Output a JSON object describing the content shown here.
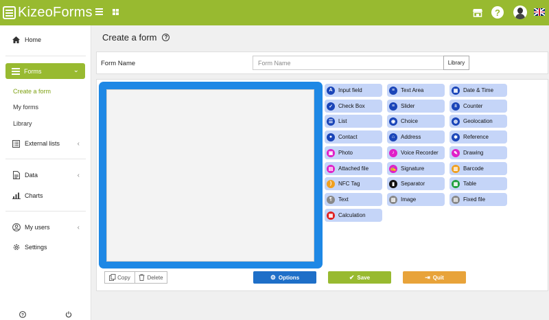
{
  "header": {
    "logo_prefix": "Kizeo",
    "logo_suffix": "Forms",
    "icons": [
      "menu-icon",
      "grid-icon",
      "store-icon",
      "help-icon",
      "avatar",
      "uk-flag-icon"
    ],
    "help_glyph": "?",
    "accent_color": "#98ba30"
  },
  "sidebar": {
    "home": "Home",
    "forms": "Forms",
    "forms_sub": [
      "Create a form",
      "My forms",
      "Library"
    ],
    "external_lists": "External lists",
    "data": "Data",
    "charts": "Charts",
    "my_users": "My users",
    "settings": "Settings"
  },
  "page": {
    "title": "Create a form",
    "title_help": "?"
  },
  "form_name": {
    "label": "Form Name",
    "value": "",
    "placeholder": "Form Name",
    "library_button": "Library"
  },
  "fields": [
    {
      "label": "Input field",
      "icon": "text-input-icon",
      "color": "#1a45b8",
      "glyph": "A"
    },
    {
      "label": "Text Area",
      "icon": "text-area-icon",
      "color": "#1a45b8",
      "glyph": "≡"
    },
    {
      "label": "Date & Time",
      "icon": "calendar-icon",
      "color": "#1a45b8",
      "glyph": "▦"
    },
    {
      "label": "Check Box",
      "icon": "checkbox-icon",
      "color": "#1a45b8",
      "glyph": "✓"
    },
    {
      "label": "Slider",
      "icon": "slider-icon",
      "color": "#1a45b8",
      "glyph": "≡"
    },
    {
      "label": "Counter",
      "icon": "counter-icon",
      "color": "#1a45b8",
      "glyph": "±"
    },
    {
      "label": "List",
      "icon": "list-icon",
      "color": "#1a45b8",
      "glyph": "☰"
    },
    {
      "label": "Choice",
      "icon": "choice-icon",
      "color": "#1a45b8",
      "glyph": "◉"
    },
    {
      "label": "Geolocation",
      "icon": "globe-icon",
      "color": "#1a45b8",
      "glyph": "◍"
    },
    {
      "label": "Contact",
      "icon": "contact-icon",
      "color": "#1a45b8",
      "glyph": "●"
    },
    {
      "label": "Address",
      "icon": "home-icon",
      "color": "#1a45b8",
      "glyph": "⌂"
    },
    {
      "label": "Reference",
      "icon": "reference-icon",
      "color": "#1a45b8",
      "glyph": "✱"
    },
    {
      "label": "Photo",
      "icon": "photo-icon",
      "color": "#e020c8",
      "glyph": "▣"
    },
    {
      "label": "Voice Recorder",
      "icon": "microphone-icon",
      "color": "#e020c8",
      "glyph": "♪"
    },
    {
      "label": "Drawing",
      "icon": "pencil-icon",
      "color": "#e020c8",
      "glyph": "✎"
    },
    {
      "label": "Attached file",
      "icon": "file-icon",
      "color": "#e020c8",
      "glyph": "▤"
    },
    {
      "label": "Signature",
      "icon": "signature-icon",
      "color": "#e020c8",
      "glyph": "✍"
    },
    {
      "label": "Barcode",
      "icon": "barcode-icon",
      "color": "#f0a020",
      "glyph": "▥"
    },
    {
      "label": "NFC Tag",
      "icon": "nfc-icon",
      "color": "#f0a020",
      "glyph": ")"
    },
    {
      "label": "Separator",
      "icon": "bookmark-icon",
      "color": "#111111",
      "glyph": "▮"
    },
    {
      "label": "Table",
      "icon": "table-icon",
      "color": "#20a040",
      "glyph": "▦"
    },
    {
      "label": "Text",
      "icon": "paragraph-icon",
      "color": "#888888",
      "glyph": "¶"
    },
    {
      "label": "Image",
      "icon": "image-icon",
      "color": "#888888",
      "glyph": "▨"
    },
    {
      "label": "Fixed file",
      "icon": "fixed-file-icon",
      "color": "#888888",
      "glyph": "▤"
    },
    {
      "label": "Calculation",
      "icon": "calculator-icon",
      "color": "#e02020",
      "glyph": "▦"
    }
  ],
  "actions": {
    "copy": "Copy",
    "delete": "Delete",
    "options": "Options",
    "save": "Save",
    "quit": "Quit",
    "options_color": "#1e6fc8",
    "save_color": "#98ba30",
    "quit_color": "#e8a33a"
  }
}
